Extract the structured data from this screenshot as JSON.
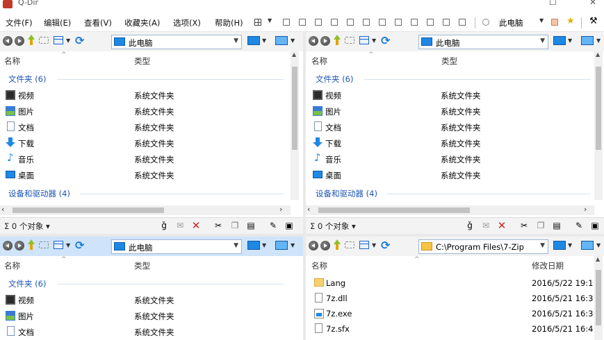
{
  "window": {
    "title": "Q-Dir"
  },
  "menu": [
    "文件(F)",
    "编辑(E)",
    "查看(V)",
    "收藏夹(A)",
    "选项(X)",
    "帮助(H)"
  ],
  "toolbar": {
    "pc_label": "此电脑"
  },
  "panes": [
    {
      "address": "此电脑",
      "col_name": "名称",
      "col_type": "类型",
      "group1": "文件夹 (6)",
      "group2": "设备和驱动器 (4)",
      "rows": [
        {
          "icon": "video-folder-icon",
          "name": "视频",
          "type": "系统文件夹"
        },
        {
          "icon": "pictures-folder-icon",
          "name": "图片",
          "type": "系统文件夹"
        },
        {
          "icon": "documents-folder-icon",
          "name": "文档",
          "type": "系统文件夹"
        },
        {
          "icon": "downloads-folder-icon",
          "name": "下载",
          "type": "系统文件夹"
        },
        {
          "icon": "music-folder-icon",
          "name": "音乐",
          "type": "系统文件夹"
        },
        {
          "icon": "desktop-folder-icon",
          "name": "桌面",
          "type": "系统文件夹"
        }
      ],
      "status": "0 个对象"
    },
    {
      "address": "此电脑",
      "col_name": "名称",
      "col_type": "类型",
      "group1": "文件夹 (6)",
      "group2": "设备和驱动器 (4)",
      "rows": [
        {
          "icon": "video-folder-icon",
          "name": "视频",
          "type": "系统文件夹"
        },
        {
          "icon": "pictures-folder-icon",
          "name": "图片",
          "type": "系统文件夹"
        },
        {
          "icon": "documents-folder-icon",
          "name": "文档",
          "type": "系统文件夹"
        },
        {
          "icon": "downloads-folder-icon",
          "name": "下载",
          "type": "系统文件夹"
        },
        {
          "icon": "music-folder-icon",
          "name": "音乐",
          "type": "系统文件夹"
        },
        {
          "icon": "desktop-folder-icon",
          "name": "桌面",
          "type": "系统文件夹"
        }
      ],
      "status": "0 个对象"
    },
    {
      "address": "此电脑",
      "col_name": "名称",
      "col_type": "类型",
      "group1": "文件夹 (6)",
      "rows": [
        {
          "icon": "video-folder-icon",
          "name": "视频",
          "type": "系统文件夹"
        },
        {
          "icon": "pictures-folder-icon",
          "name": "图片",
          "type": "系统文件夹"
        },
        {
          "icon": "documents-folder-icon",
          "name": "文档",
          "type": "系统文件夹"
        }
      ]
    },
    {
      "address": "C:\\Program Files\\7-Zip",
      "col_name": "名称",
      "col_modified": "修改日期",
      "rows": [
        {
          "icon": "folder-icon",
          "name": "Lang",
          "date": "2016/5/22 19:1"
        },
        {
          "icon": "dll-file-icon",
          "name": "7z.dll",
          "date": "2016/5/21 16:3"
        },
        {
          "icon": "exe-file-icon",
          "name": "7z.exe",
          "date": "2016/5/21 16:3"
        },
        {
          "icon": "sfx-file-icon",
          "name": "7z.sfx",
          "date": "2016/5/21 16:4"
        }
      ]
    }
  ]
}
